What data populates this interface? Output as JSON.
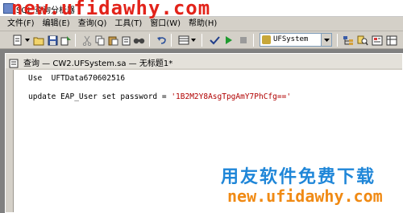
{
  "window": {
    "title": "SQL 查询分析器"
  },
  "watermark": {
    "top_url": "new.ufidawhy.com",
    "brand": "用友软件免费下载",
    "bottom_url": "new.ufidawhy.com"
  },
  "menu": {
    "items": [
      {
        "label": "文件(F)"
      },
      {
        "label": "编辑(E)"
      },
      {
        "label": "查询(Q)"
      },
      {
        "label": "工具(T)"
      },
      {
        "label": "窗口(W)"
      },
      {
        "label": "帮助(H)"
      }
    ]
  },
  "toolbar": {
    "database_select": {
      "value": "UFSystem"
    },
    "icons": [
      "new-query-icon",
      "open-icon",
      "save-icon",
      "load-icon",
      "cut-icon",
      "copy-icon",
      "paste-icon",
      "clear-icon",
      "find-icon",
      "undo-icon",
      "execute-mode-icon",
      "check-icon",
      "run-icon",
      "stop-icon",
      "object-browser-icon",
      "object-search-icon",
      "properties-icon",
      "results-icon"
    ]
  },
  "query_window": {
    "title": "查询 — CW2.UFSystem.sa — 无标题1*",
    "lines": [
      {
        "keyword": "Use",
        "rest": "  UFTData670602516"
      },
      {
        "keyword": "update",
        "rest": " EAP_User set password = ",
        "string": "'1B2M2Y8AsgTpgAmY7PhCfg=='"
      }
    ]
  },
  "colors": {
    "watermark_red": "#e2231a",
    "watermark_blue": "#1f86d8",
    "watermark_orange": "#f08a14",
    "string_literal": "#b00000"
  }
}
